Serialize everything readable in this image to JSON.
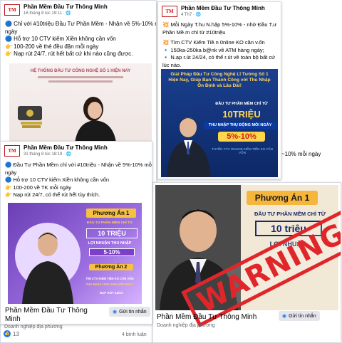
{
  "post1": {
    "page_name": "Phần Mềm Đầu Tư Thông Minh",
    "date": "16 tháng 8 lúc 19:11 · 🌐",
    "lines": [
      "🔵 Chỉ với #10triệu Đầu Tư Phần Mềm - Nhận về 5%-10% mỗi",
      "ngày",
      "🔵 Hỗ trợ 10 CTV kiếm Xiền không cần vốn",
      "👉 100-200 về thẻ đều đặn mỗi ngày",
      "👉 Nạp rút 24/7, rút hết bất cứ khi nào cũng được."
    ],
    "banner_title": "HỆ THỐNG ĐẦU TƯ CÔNG NGHỆ SỐ 1 HIỆN NAY",
    "reactions": "13",
    "comments": "4 bình luận"
  },
  "post2": {
    "page_name": "Phần Mềm Đầu Tư Thông Minh",
    "date": "4 Th7 · 🌐",
    "lines": [
      "💥 Mỗi Ngày T.hu N.hập 5%-10% - nhờ Đầu T.ư",
      "Phần Mề.m chỉ từ #10triệu",
      "",
      "💥 Tìm CTV Kiếm Tiề.n 0nline KO cần v.ốn",
      "🔹 150ka-250ka b@nk về ATM hàng ngày;",
      "🔹 N.ạp r.út 24/24, có thể r.út về toàn bộ bất cứ",
      "lúc nào."
    ],
    "banner_heading": "Giải Pháp Đầu Tư Công Nghệ Lĩ Tưởng Số 1 Hiện Nay, Giúp Bạn Thành Công với Thu Nhập Ổn Định và Lâu Dài!",
    "banner_sub": "ĐẦU TƯ PHẦN MỀM CHỈ TỪ",
    "banner_amount": "10TRIỆU",
    "banner_profit_label": "THU NHẬP THỤ ĐỘNG MỖI NGÀY",
    "banner_profit": "5%-10%",
    "banner_footer": "TUYỂN CTV ONLINE KIẾM TIỀN KO CẦN VỐN",
    "overflow_text": "~10% mỗi ngày"
  },
  "post3": {
    "page_name": "Phần Mềm Đầu Tư Thông Minh",
    "date": "31 tháng 8 lúc 18:19 · 🌐",
    "lines": [
      "🔵 Đầu Tư Phần Mềm chỉ với #10triệu - Nhận về 5%-10% mỗi",
      "ngày",
      "🔵 Hỗ trợ 10 CTV kiếm Xiền không cần vốn",
      "👉 100-200 về TK mỗi ngày",
      "👉 Nạp rút 24/7, có thể rút hết tùy thích."
    ],
    "plan1": "Phương Án 1",
    "plan1_sub": "ĐẦU TƯ PHẦN MỀM CHỈ TỪ",
    "plan1_amount": "10 TRIỆU",
    "plan1_profit_label": "LỢI NHUẬN THU NHẬP",
    "plan1_profit": "5-10%",
    "plan2": "Phương Án 2",
    "plan2_sub": "TÌM CTV KIẾM TIỀN KO CẦN VỐN",
    "plan2_amount": "THU NHẬP 100K-200K MỖI NGÀY",
    "plan2_footer": "NẠP RÚT 24/24",
    "bottom_name_1": "Phần Mềm Đầu Tư Thông",
    "bottom_name_2": "Minh",
    "bottom_sub": "Doanh nghiệp địa phương",
    "message_btn": "Gửi tin nhắn"
  },
  "post4": {
    "plan_label": "Phương Án 1",
    "sub": "ĐẦU TƯ PHẦN MỀM CHỈ TỪ",
    "amount": "10 triệu",
    "profit": "LỢI NHUẬN",
    "bottom_name": "Phần Mềm Đầu Tư Thông Minh",
    "bottom_sub": "Doanh nghiệp địa phương",
    "message_btn": "Gửi tin nhắn"
  },
  "stamp_text": "WARNING"
}
